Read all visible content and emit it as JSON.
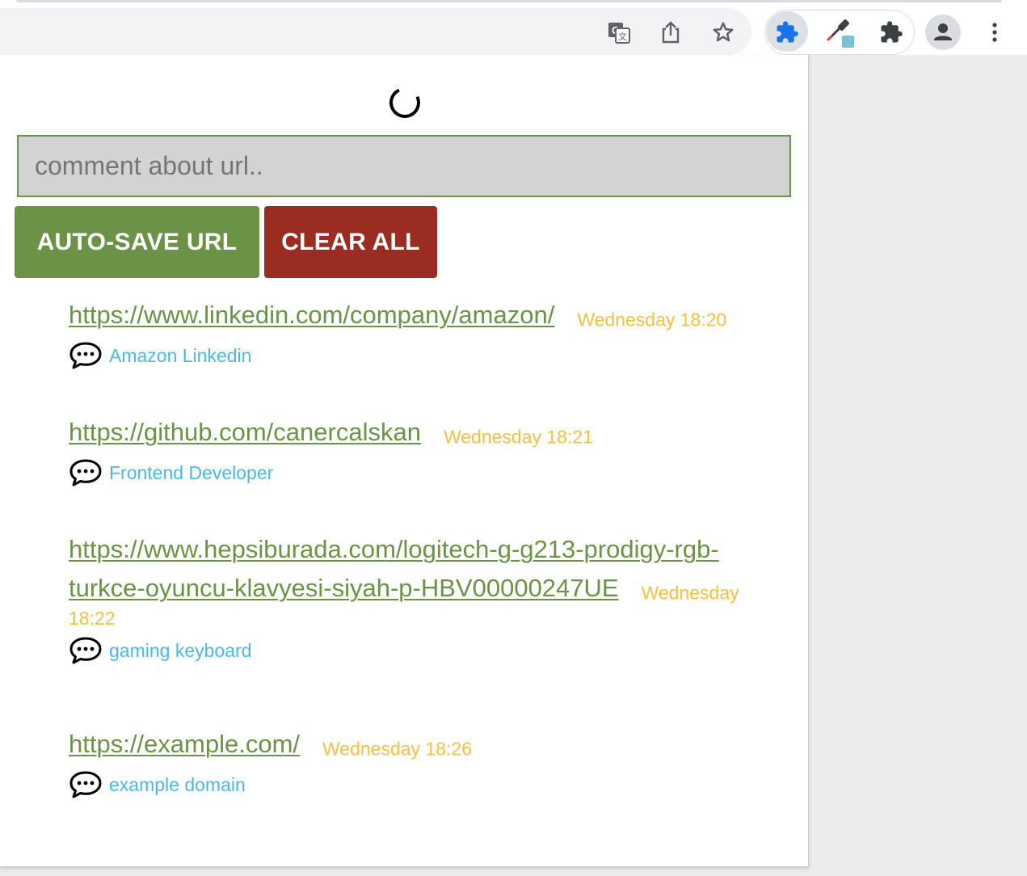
{
  "browser": {
    "toolbar_icons": [
      "translate-icon",
      "share-icon",
      "bookmark-star-icon",
      "extension-puzzle-icon",
      "eyedropper-icon",
      "extensions-menu-icon",
      "profile-icon",
      "more-menu-icon"
    ],
    "eyedropper_badge": "."
  },
  "popup": {
    "comment_placeholder": "comment about url..",
    "comment_value": "",
    "auto_save_label": "AUTO-SAVE URL",
    "clear_all_label": "CLEAR ALL",
    "colors": {
      "accent_green": "#6a9347",
      "danger_red": "#9b2c22",
      "timestamp_yellow": "#f0c146",
      "comment_blue": "#4bb8e3"
    },
    "entries": [
      {
        "url": "https://www.linkedin.com/company/amazon/",
        "timestamp": "Wednesday 18:20",
        "comment": "Amazon Linkedin"
      },
      {
        "url": "https://github.com/canercalskan",
        "timestamp": "Wednesday 18:21",
        "comment": "Frontend Developer"
      },
      {
        "url": "https://www.hepsiburada.com/logitech-g-g213-prodigy-rgb-turkce-oyuncu-klavyesi-siyah-p-HBV00000247UE",
        "timestamp": "Wednesday 18:22",
        "comment": "gaming keyboard"
      },
      {
        "url": "https://example.com/",
        "timestamp": "Wednesday 18:26",
        "comment": "example domain"
      }
    ]
  }
}
